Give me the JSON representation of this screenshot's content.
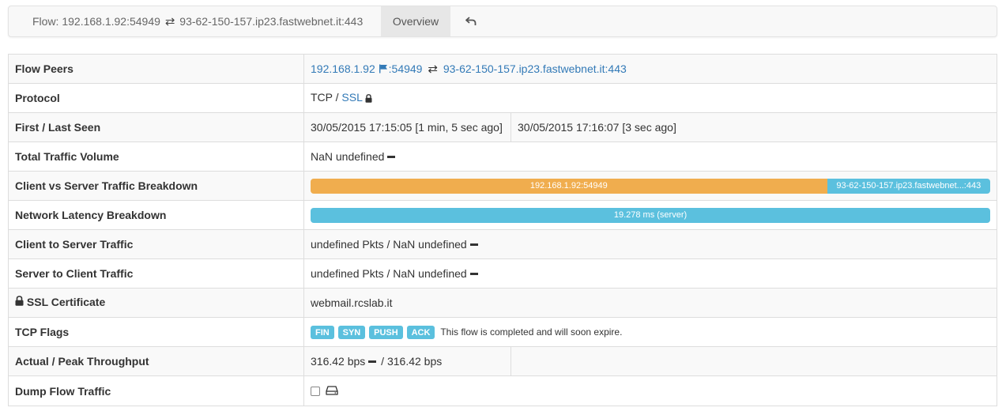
{
  "navbar": {
    "flow_prefix": "Flow: ",
    "client": "192.168.1.92:54949",
    "swap_glyph": "⇄",
    "server": "93-62-150-157.ip23.fastwebnet.it:443",
    "tab_overview": "Overview",
    "back_icon": "reply-arrow-icon"
  },
  "rows": {
    "flow_peers": {
      "label": "Flow Peers",
      "client_host": "192.168.1.92",
      "client_port": ":54949",
      "server_host": "93-62-150-157.ip23.fastwebnet.it",
      "server_port": ":443"
    },
    "protocol": {
      "label": "Protocol",
      "l4": "TCP",
      "separator": " / ",
      "l7": "SSL"
    },
    "seen": {
      "label": "First / Last Seen",
      "first": "30/05/2015 17:15:05 [1 min, 5 sec ago]",
      "last": "30/05/2015 17:16:07 [3 sec ago]"
    },
    "total_volume": {
      "label": "Total Traffic Volume",
      "value": "NaN undefined"
    },
    "breakdown": {
      "label": "Client vs Server Traffic Breakdown",
      "client_label": "192.168.1.92:54949",
      "server_label": "93-62-150-157.ip23.fastwebnet...:443",
      "client_fraction": 0.76,
      "server_fraction": 0.24
    },
    "latency": {
      "label": "Network Latency Breakdown",
      "server_label": "19.278 ms (server)",
      "server_fraction": 1.0
    },
    "c2s": {
      "label": "Client to Server Traffic",
      "value": "undefined Pkts / NaN undefined"
    },
    "s2c": {
      "label": "Server to Client Traffic",
      "value": "undefined Pkts / NaN undefined"
    },
    "ssl_cert": {
      "label": "SSL Certificate",
      "value": "webmail.rcslab.it"
    },
    "tcp_flags": {
      "label": "TCP Flags",
      "flags": [
        "FIN",
        "SYN",
        "PUSH",
        "ACK"
      ],
      "note": "This flow is completed and will soon expire."
    },
    "throughput": {
      "label": "Actual / Peak Throughput",
      "actual": "316.42 bps",
      "peak": " / 316.42 bps"
    },
    "dump": {
      "label": "Dump Flow Traffic",
      "checked": false
    }
  },
  "colors": {
    "link": "#337ab7",
    "client_bar": "#f0ad4e",
    "server_bar": "#5bc0de",
    "flag_bg": "#5bc0de"
  }
}
